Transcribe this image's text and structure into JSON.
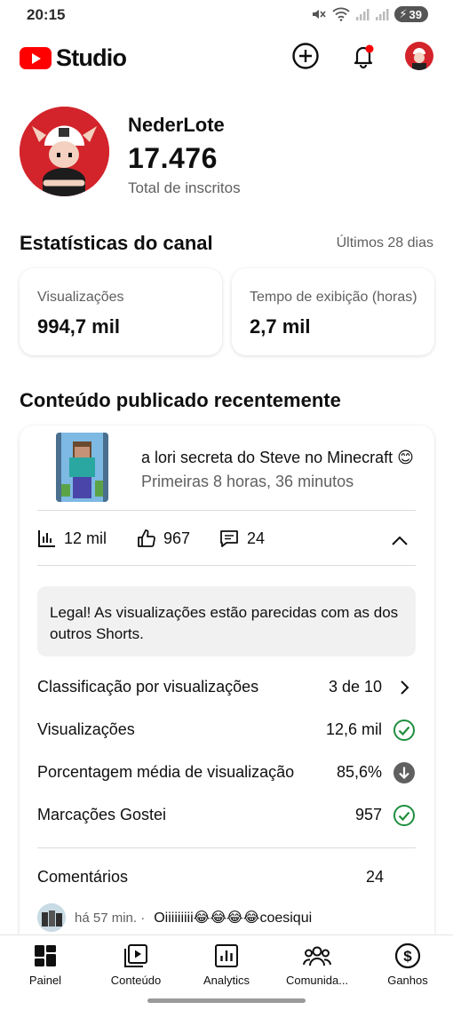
{
  "status_bar": {
    "time": "20:15",
    "battery": "39"
  },
  "app": {
    "logo_text": "Studio"
  },
  "channel": {
    "name": "NederLote",
    "subscribers": "17.476",
    "subscribers_label": "Total de inscritos"
  },
  "stats": {
    "title": "Estatísticas do canal",
    "period": "Últimos 28 dias",
    "cards": [
      {
        "label": "Visualizações",
        "value": "994,7 mil"
      },
      {
        "label": "Tempo de exibição (horas)",
        "value": "2,7 mil"
      }
    ]
  },
  "recent": {
    "title": "Conteúdo publicado recentemente",
    "video": {
      "title": "a lori secreta do Steve no Minecraft 😊",
      "subtitle": "Primeiras 8 horas, 36 minutos",
      "views": "12 mil",
      "likes": "967",
      "comments": "24"
    },
    "insight": "Legal! As visualizações estão parecidas com as dos outros Shorts.",
    "rows": [
      {
        "label": "Classificação por visualizações",
        "value": "3 de 10",
        "icon": "chevron-right-icon"
      },
      {
        "label": "Visualizações",
        "value": "12,6 mil",
        "icon": "check-circle-icon"
      },
      {
        "label": "Porcentagem média de visualização",
        "value": "85,6%",
        "icon": "arrow-down-circle-icon"
      },
      {
        "label": "Marcações Gostei",
        "value": "957",
        "icon": "check-circle-icon"
      }
    ],
    "comments_label": "Comentários",
    "comments_count": "24",
    "latest_comment": {
      "meta": "há 57 min. ·",
      "text": "Oiiiiiiiii😂😂😂😂coesiqui"
    }
  },
  "nav": [
    {
      "label": "Painel",
      "icon": "dashboard-icon"
    },
    {
      "label": "Conteúdo",
      "icon": "content-icon"
    },
    {
      "label": "Analytics",
      "icon": "analytics-icon"
    },
    {
      "label": "Comunida...",
      "icon": "community-icon"
    },
    {
      "label": "Ganhos",
      "icon": "earnings-icon"
    }
  ],
  "colors": {
    "accent_red": "#ff0000",
    "success_green": "#1e8e3e",
    "text_secondary": "#606060"
  }
}
